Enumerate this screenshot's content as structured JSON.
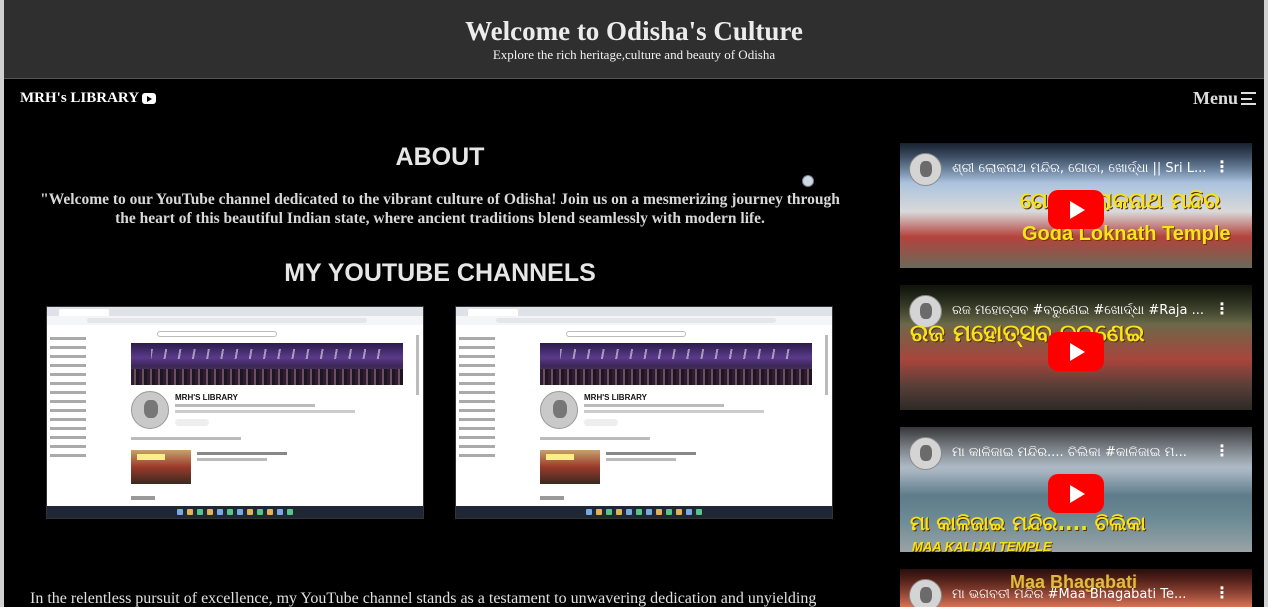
{
  "header": {
    "title": "Welcome to Odisha's Culture",
    "subtitle": "Explore the rich heritage,culture and beauty of Odisha"
  },
  "nav": {
    "brand": "MRH's LIBRARY",
    "menu_label": "Menu"
  },
  "about": {
    "title": "ABOUT",
    "text": "\"Welcome to our YouTube channel dedicated to the vibrant culture of Odisha! Join us on a mesmerizing journey through the heart of this beautiful Indian state, where ancient traditions blend seamlessly with modern life."
  },
  "channels": {
    "title": "MY YOUTUBE CHANNELS",
    "screenshots": [
      {
        "channel_name": "MRH'S LIBRARY"
      },
      {
        "channel_name": "MRH'S LIBRARY"
      }
    ]
  },
  "paragraph": "In the relentless pursuit of excellence, my YouTube channel stands as a testament to unwavering dedication and unyielding",
  "videos": [
    {
      "title": "ଶ୍ରୀ ଲୋକନାଥ ମନ୍ଦିର, ଗୋଡା, ଖୋର୍ଦ୍ଧା || Sri L...",
      "overlay": "ଗୋଡା ଲୋକନାଥ ମନ୍ଦିର",
      "caption": "Goda Loknath Temple"
    },
    {
      "title": "ରଜ ମହୋତ୍ସବ #ବରୁଣେଇ #ଖୋର୍ଦ୍ଧା #Raja ...",
      "overlay": "ରଜ ମହୋତ୍ସବ ବରୁଣେଇ",
      "caption": ""
    },
    {
      "title": "ମା କାଳିଜାଇ ମନ୍ଦିର.... ଚିଲିକା #କାଳିଜାଇ ମ...",
      "overlay": "ମା କାଳିଜାଇ ମନ୍ଦିର.... ଚିଲିକା",
      "caption": "MAA KALIJAI TEMPLE"
    },
    {
      "title": "ମା ଭଗବତୀ ମନ୍ଦିର #Maa Bhagabati Te...",
      "overlay": "",
      "caption": "Maa Bhagabati"
    }
  ]
}
